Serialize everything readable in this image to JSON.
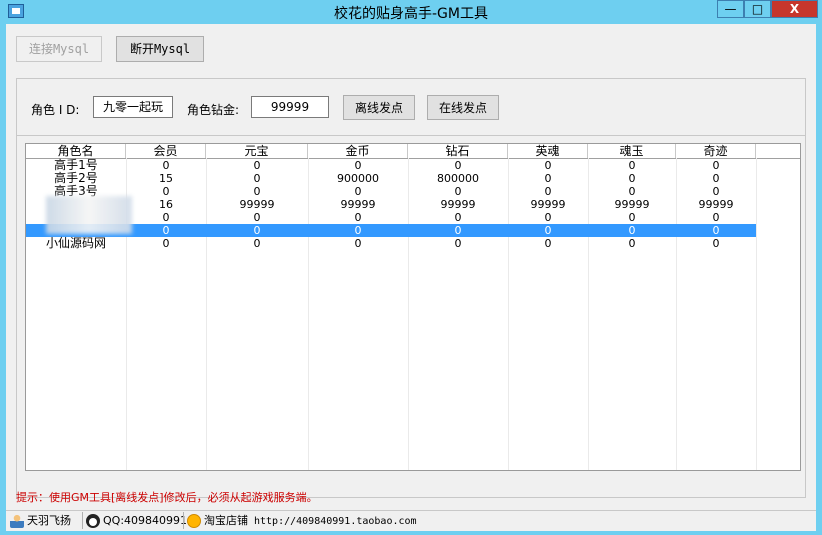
{
  "window": {
    "title": "校花的贴身高手-GM工具",
    "minimize_glyph": "—",
    "maximize_glyph": "□",
    "close_glyph": "X"
  },
  "toolbar": {
    "connect_label": "连接Mysql",
    "disconnect_label": "断开Mysql"
  },
  "form": {
    "role_id_label": "角色 I D:",
    "role_id_value": "九零一起玩",
    "diamond_label": "角色钻金:",
    "diamond_value": "99999",
    "offline_send_label": "离线发点",
    "online_send_label": "在线发点"
  },
  "table": {
    "columns": [
      "角色名",
      "会员",
      "元宝",
      "金币",
      "钻石",
      "英魂",
      "魂玉",
      "奇迹"
    ],
    "rows": [
      {
        "name": "高手1号",
        "values": [
          "0",
          "0",
          "0",
          "0",
          "0",
          "0",
          "0"
        ]
      },
      {
        "name": "高手2号",
        "values": [
          "15",
          "0",
          "900000",
          "800000",
          "0",
          "0",
          "0"
        ]
      },
      {
        "name": "高手3号",
        "values": [
          "0",
          "0",
          "0",
          "0",
          "0",
          "0",
          "0"
        ]
      },
      {
        "name": "",
        "values": [
          "16",
          "99999",
          "99999",
          "99999",
          "99999",
          "99999",
          "99999"
        ]
      },
      {
        "name": "",
        "values": [
          "0",
          "0",
          "0",
          "0",
          "0",
          "0",
          "0"
        ]
      },
      {
        "name": "",
        "values": [
          "0",
          "0",
          "0",
          "0",
          "0",
          "0",
          "0"
        ],
        "selected": true
      },
      {
        "name": "小仙源码网",
        "values": [
          "0",
          "0",
          "0",
          "0",
          "0",
          "0",
          "0"
        ]
      }
    ]
  },
  "hint": "提示：使用GM工具[离线发点]修改后，必须从起游戏服务端。",
  "status": {
    "author": "天羽飞扬",
    "qq": "QQ:409840991",
    "shop_label": "淘宝店铺",
    "shop_url": "http://409840991.taobao.com"
  },
  "colors": {
    "titlebar": "#6ecff0",
    "selection": "#3399ff",
    "hint": "#cc0000",
    "close_button": "#c6362c"
  }
}
